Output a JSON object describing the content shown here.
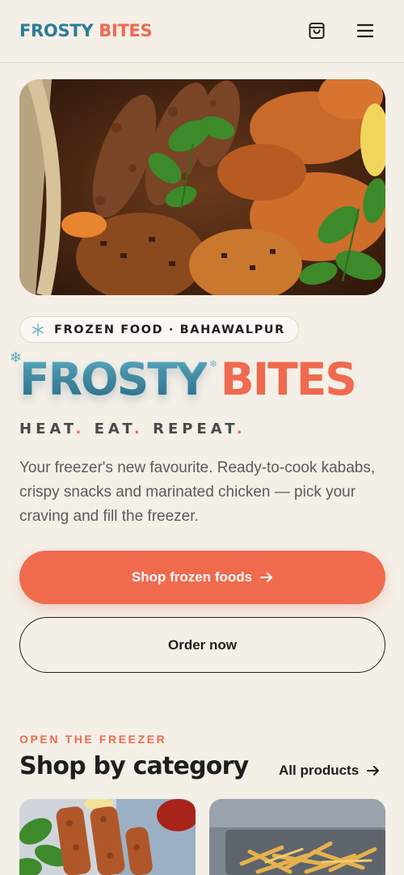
{
  "header": {
    "logo_part1": "FROSTY",
    "logo_part2": "BITES",
    "cart_icon": "shopping-bag-icon",
    "menu_icon": "hamburger-menu-icon"
  },
  "hero": {
    "image_icon": "kabab-platter-image",
    "badge": "FROZEN FOOD · BAHAWALPUR",
    "title_part1": "FROSTY",
    "title_part2": "BITES",
    "tagline": [
      "HEAT",
      "EAT",
      "REPEAT"
    ],
    "description": "Your freezer's new favourite. Ready-to-cook kababs, crispy snacks and marinated chicken — pick your craving and fill the freezer.",
    "primary_button": "Shop frozen foods",
    "secondary_button": "Order now"
  },
  "category_section": {
    "eyebrow": "OPEN THE FREEZER",
    "title": "Shop by category",
    "all_link": "All products"
  },
  "colors": {
    "background": "#f4efe7",
    "brand_blue": "#2a7d97",
    "brand_coral": "#ef6a4f",
    "text": "#1e1e1e"
  }
}
